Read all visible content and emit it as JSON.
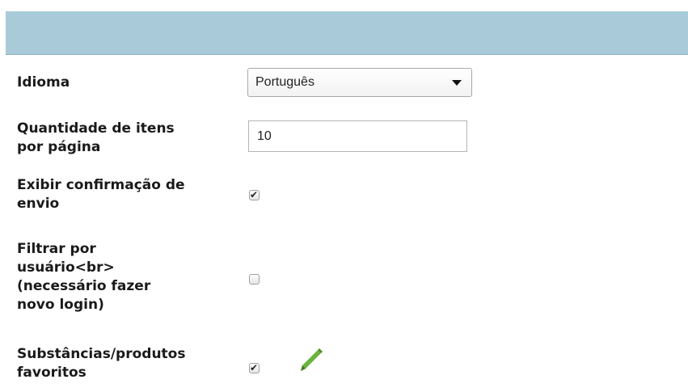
{
  "settings": {
    "language": {
      "label": "Idioma",
      "value": "Português"
    },
    "items_per_page": {
      "label_line1": "Quantidade de itens",
      "label_line2": "por página",
      "value": "10"
    },
    "send_confirmation": {
      "label_line1": "Exibir confirmação de",
      "label_line2": "envio",
      "checked": true
    },
    "filter_by_user": {
      "label_line1": "Filtrar por",
      "label_line2": "usuário<br>",
      "label_line3": "(necessário fazer",
      "label_line4": "novo login)",
      "checked": false
    },
    "favorites": {
      "label_line1": "Substâncias/produtos",
      "label_line2": "favoritos",
      "checked": true,
      "edit_icon": "pencil-icon"
    }
  },
  "colors": {
    "header_bar": "#a9cad8",
    "pencil": "#6cb33f"
  }
}
